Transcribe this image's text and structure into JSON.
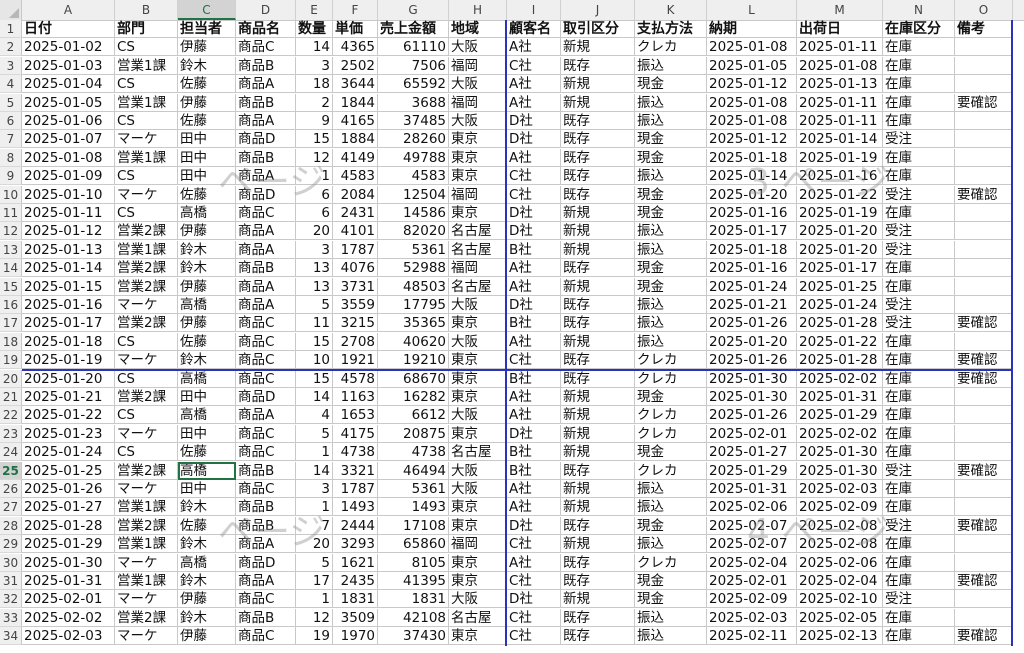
{
  "columns": [
    "A",
    "B",
    "C",
    "D",
    "E",
    "F",
    "G",
    "H",
    "I",
    "J",
    "K",
    "L",
    "M",
    "N",
    "O"
  ],
  "selected_column": "C",
  "selected_row": 25,
  "header_row": [
    "日付",
    "部門",
    "担当者",
    "商品名",
    "数量",
    "単価",
    "売上金額",
    "地域",
    "顧客名",
    "取引区分",
    "支払方法",
    "納期",
    "出荷日",
    "在庫区分",
    "備考"
  ],
  "rows": [
    [
      "2025-01-02",
      "CS",
      "伊藤",
      "商品C",
      "14",
      "4365",
      "61110",
      "大阪",
      "A社",
      "新規",
      "クレカ",
      "2025-01-08",
      "2025-01-11",
      "在庫",
      ""
    ],
    [
      "2025-01-03",
      "営業1課",
      "鈴木",
      "商品B",
      "3",
      "2502",
      "7506",
      "福岡",
      "C社",
      "既存",
      "振込",
      "2025-01-05",
      "2025-01-08",
      "在庫",
      ""
    ],
    [
      "2025-01-04",
      "CS",
      "佐藤",
      "商品A",
      "18",
      "3644",
      "65592",
      "大阪",
      "A社",
      "新規",
      "現金",
      "2025-01-12",
      "2025-01-13",
      "在庫",
      ""
    ],
    [
      "2025-01-05",
      "営業1課",
      "伊藤",
      "商品B",
      "2",
      "1844",
      "3688",
      "福岡",
      "A社",
      "新規",
      "振込",
      "2025-01-08",
      "2025-01-11",
      "在庫",
      "要確認"
    ],
    [
      "2025-01-06",
      "CS",
      "佐藤",
      "商品A",
      "9",
      "4165",
      "37485",
      "大阪",
      "D社",
      "既存",
      "振込",
      "2025-01-08",
      "2025-01-11",
      "在庫",
      ""
    ],
    [
      "2025-01-07",
      "マーケ",
      "田中",
      "商品D",
      "15",
      "1884",
      "28260",
      "東京",
      "D社",
      "既存",
      "現金",
      "2025-01-12",
      "2025-01-14",
      "受注",
      ""
    ],
    [
      "2025-01-08",
      "営業1課",
      "田中",
      "商品B",
      "12",
      "4149",
      "49788",
      "東京",
      "A社",
      "既存",
      "現金",
      "2025-01-18",
      "2025-01-19",
      "在庫",
      ""
    ],
    [
      "2025-01-09",
      "CS",
      "田中",
      "商品A",
      "1",
      "4583",
      "4583",
      "東京",
      "C社",
      "既存",
      "振込",
      "2025-01-14",
      "2025-01-16",
      "在庫",
      ""
    ],
    [
      "2025-01-10",
      "マーケ",
      "佐藤",
      "商品D",
      "6",
      "2084",
      "12504",
      "福岡",
      "C社",
      "既存",
      "現金",
      "2025-01-20",
      "2025-01-22",
      "受注",
      "要確認"
    ],
    [
      "2025-01-11",
      "CS",
      "高橋",
      "商品C",
      "6",
      "2431",
      "14586",
      "東京",
      "D社",
      "新規",
      "現金",
      "2025-01-16",
      "2025-01-19",
      "在庫",
      ""
    ],
    [
      "2025-01-12",
      "営業2課",
      "伊藤",
      "商品A",
      "20",
      "4101",
      "82020",
      "名古屋",
      "D社",
      "新規",
      "振込",
      "2025-01-17",
      "2025-01-20",
      "受注",
      ""
    ],
    [
      "2025-01-13",
      "営業1課",
      "鈴木",
      "商品A",
      "3",
      "1787",
      "5361",
      "名古屋",
      "B社",
      "新規",
      "振込",
      "2025-01-18",
      "2025-01-20",
      "受注",
      ""
    ],
    [
      "2025-01-14",
      "営業2課",
      "鈴木",
      "商品B",
      "13",
      "4076",
      "52988",
      "福岡",
      "A社",
      "既存",
      "現金",
      "2025-01-16",
      "2025-01-17",
      "在庫",
      ""
    ],
    [
      "2025-01-15",
      "営業2課",
      "伊藤",
      "商品A",
      "13",
      "3731",
      "48503",
      "名古屋",
      "A社",
      "新規",
      "現金",
      "2025-01-24",
      "2025-01-25",
      "在庫",
      ""
    ],
    [
      "2025-01-16",
      "マーケ",
      "高橋",
      "商品A",
      "5",
      "3559",
      "17795",
      "大阪",
      "D社",
      "既存",
      "振込",
      "2025-01-21",
      "2025-01-24",
      "受注",
      ""
    ],
    [
      "2025-01-17",
      "営業2課",
      "伊藤",
      "商品C",
      "11",
      "3215",
      "35365",
      "東京",
      "B社",
      "既存",
      "振込",
      "2025-01-26",
      "2025-01-28",
      "受注",
      "要確認"
    ],
    [
      "2025-01-18",
      "CS",
      "佐藤",
      "商品C",
      "15",
      "2708",
      "40620",
      "大阪",
      "A社",
      "新規",
      "振込",
      "2025-01-20",
      "2025-01-22",
      "在庫",
      ""
    ],
    [
      "2025-01-19",
      "マーケ",
      "鈴木",
      "商品C",
      "10",
      "1921",
      "19210",
      "東京",
      "C社",
      "既存",
      "クレカ",
      "2025-01-26",
      "2025-01-28",
      "在庫",
      "要確認"
    ],
    [
      "2025-01-20",
      "CS",
      "高橋",
      "商品C",
      "15",
      "4578",
      "68670",
      "東京",
      "B社",
      "既存",
      "クレカ",
      "2025-01-30",
      "2025-02-02",
      "在庫",
      "要確認"
    ],
    [
      "2025-01-21",
      "営業2課",
      "田中",
      "商品D",
      "14",
      "1163",
      "16282",
      "東京",
      "A社",
      "新規",
      "現金",
      "2025-01-30",
      "2025-01-31",
      "在庫",
      ""
    ],
    [
      "2025-01-22",
      "CS",
      "高橋",
      "商品A",
      "4",
      "1653",
      "6612",
      "大阪",
      "A社",
      "新規",
      "クレカ",
      "2025-01-26",
      "2025-01-29",
      "在庫",
      ""
    ],
    [
      "2025-01-23",
      "マーケ",
      "田中",
      "商品C",
      "5",
      "4175",
      "20875",
      "東京",
      "D社",
      "新規",
      "クレカ",
      "2025-02-01",
      "2025-02-02",
      "在庫",
      ""
    ],
    [
      "2025-01-24",
      "CS",
      "佐藤",
      "商品C",
      "1",
      "4738",
      "4738",
      "名古屋",
      "B社",
      "新規",
      "現金",
      "2025-01-27",
      "2025-01-30",
      "在庫",
      ""
    ],
    [
      "2025-01-25",
      "営業2課",
      "高橋",
      "商品B",
      "14",
      "3321",
      "46494",
      "大阪",
      "B社",
      "既存",
      "クレカ",
      "2025-01-29",
      "2025-01-30",
      "受注",
      "要確認"
    ],
    [
      "2025-01-26",
      "マーケ",
      "田中",
      "商品C",
      "3",
      "1787",
      "5361",
      "大阪",
      "A社",
      "新規",
      "振込",
      "2025-01-31",
      "2025-02-03",
      "在庫",
      ""
    ],
    [
      "2025-01-27",
      "営業1課",
      "鈴木",
      "商品B",
      "1",
      "1493",
      "1493",
      "東京",
      "A社",
      "新規",
      "振込",
      "2025-02-06",
      "2025-02-09",
      "在庫",
      ""
    ],
    [
      "2025-01-28",
      "営業2課",
      "佐藤",
      "商品B",
      "7",
      "2444",
      "17108",
      "東京",
      "D社",
      "既存",
      "現金",
      "2025-02-07",
      "2025-02-08",
      "受注",
      "要確認"
    ],
    [
      "2025-01-29",
      "営業1課",
      "鈴木",
      "商品A",
      "20",
      "3293",
      "65860",
      "福岡",
      "C社",
      "新規",
      "振込",
      "2025-02-07",
      "2025-02-08",
      "在庫",
      ""
    ],
    [
      "2025-01-30",
      "マーケ",
      "高橋",
      "商品D",
      "5",
      "1621",
      "8105",
      "東京",
      "A社",
      "既存",
      "クレカ",
      "2025-02-04",
      "2025-02-06",
      "在庫",
      ""
    ],
    [
      "2025-01-31",
      "営業1課",
      "鈴木",
      "商品A",
      "17",
      "2435",
      "41395",
      "東京",
      "C社",
      "既存",
      "現金",
      "2025-02-01",
      "2025-02-04",
      "在庫",
      "要確認"
    ],
    [
      "2025-02-01",
      "マーケ",
      "伊藤",
      "商品C",
      "1",
      "1831",
      "1831",
      "大阪",
      "D社",
      "新規",
      "現金",
      "2025-02-09",
      "2025-02-10",
      "受注",
      ""
    ],
    [
      "2025-02-02",
      "営業2課",
      "鈴木",
      "商品B",
      "12",
      "3509",
      "42108",
      "名古屋",
      "C社",
      "既存",
      "振込",
      "2025-02-03",
      "2025-02-05",
      "在庫",
      ""
    ],
    [
      "2025-02-03",
      "マーケ",
      "伊藤",
      "商品C",
      "19",
      "1970",
      "37430",
      "東京",
      "C社",
      "既存",
      "振込",
      "2025-02-11",
      "2025-02-13",
      "在庫",
      "要確認"
    ]
  ],
  "watermarks": [
    {
      "text": "ページ",
      "row": 9,
      "col": "C"
    },
    {
      "text": "3 ページ",
      "row": 9,
      "col": "L"
    },
    {
      "text": "ページ",
      "row": 28,
      "col": "C"
    },
    {
      "text": "4 ページ",
      "row": 28,
      "col": "L"
    }
  ],
  "colors": {
    "page_break": "#2b33b8",
    "selection": "#217346"
  }
}
